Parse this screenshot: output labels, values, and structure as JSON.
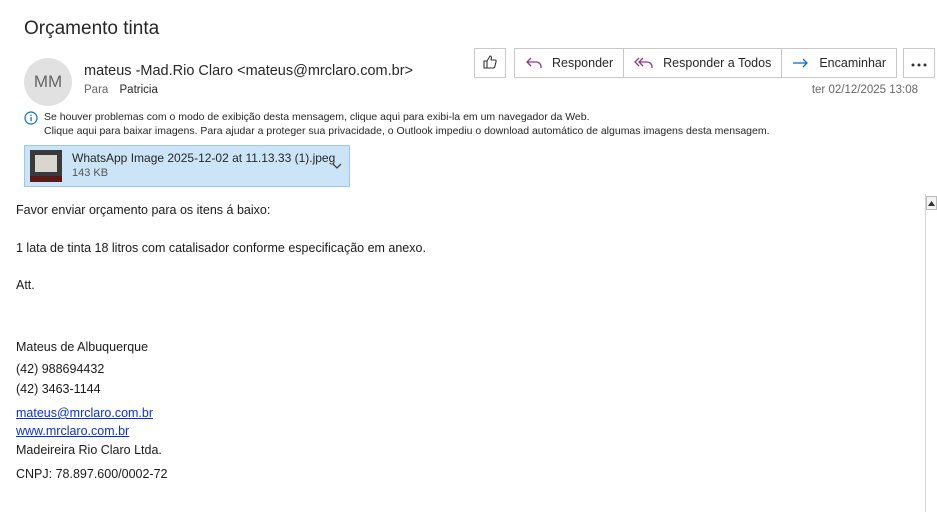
{
  "email": {
    "subject": "Orçamento tinta",
    "avatar_initials": "MM",
    "sender": "mateus -Mad.Rio Claro <mateus@mrclaro.com.br>",
    "to_label": "Para",
    "to_name": "Patricia",
    "datetime": "ter 02/12/2025 13:08"
  },
  "toolbar": {
    "like_icon": "thumbs-up-icon",
    "reply_label": "Responder",
    "reply_all_label": "Responder a Todos",
    "forward_label": "Encaminhar",
    "more_icon": "more-icon"
  },
  "info": {
    "line1": "Se houver problemas com o modo de exibição desta mensagem, clique aqui para exibi-la em um navegador da Web.",
    "line2": "Clique aqui para baixar imagens. Para ajudar a proteger sua privacidade, o Outlook impediu o download automático de algumas imagens desta mensagem."
  },
  "attachment": {
    "name": "WhatsApp Image 2025-12-02 at 11.13.33 (1).jpeg",
    "size": "143 KB"
  },
  "body": {
    "line1": "Favor enviar orçamento para os itens á baixo:",
    "line2": "1 lata de tinta 18 litros com catalisador conforme especificação em anexo.",
    "line3": "Att.",
    "sig_name": "Mateus de Albuquerque",
    "phone1": "(42) 988694432",
    "phone2": "(42) 3463-1144",
    "email_link": "mateus@mrclaro.com.br",
    "web_link": "www.mrclaro.com.br",
    "company": "Madeireira Rio Claro Ltda.",
    "cnpj": "CNPJ: 78.897.600/0002-72"
  },
  "colors": {
    "accent": "#0b6ec5",
    "attachment_bg": "#cce4f7",
    "link": "#0b2fd6"
  }
}
